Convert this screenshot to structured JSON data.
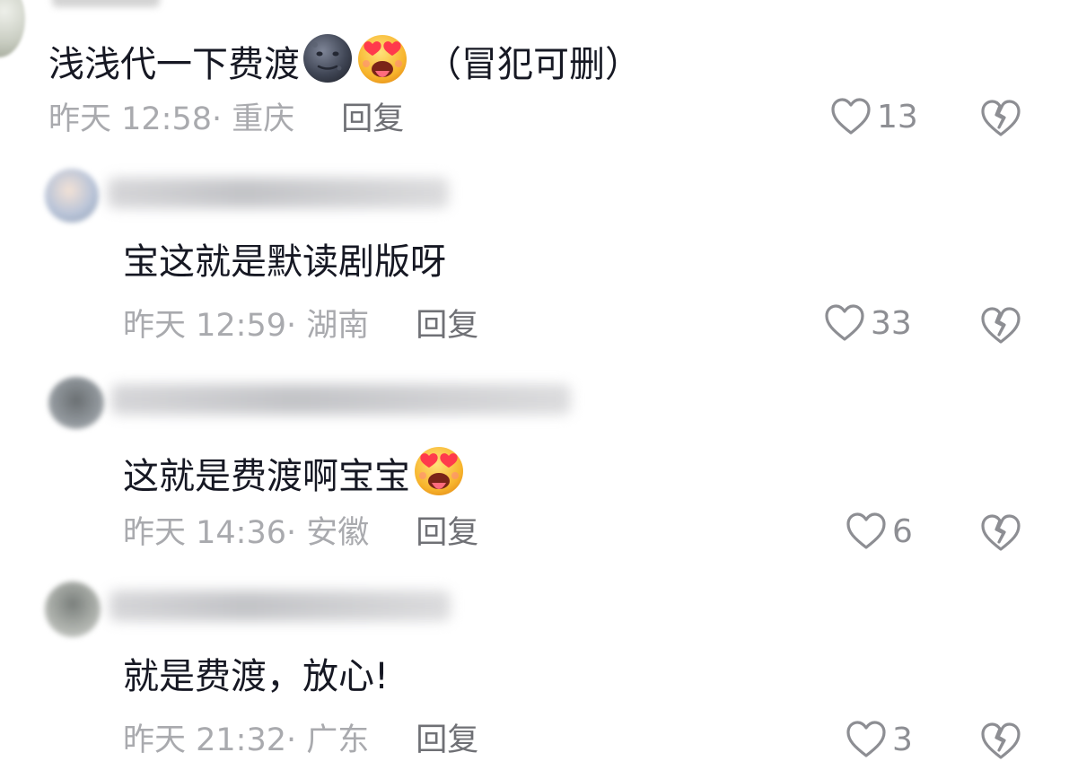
{
  "comments": [
    {
      "text": "浅浅代一下费渡",
      "suffix": "（冒犯可删）",
      "time": "昨天 12:58· 重庆",
      "reply": "回复",
      "likes": "13",
      "emojis": [
        "new-moon-face-emoji",
        "heart-eyes-tongue-emoji"
      ]
    },
    {
      "text": "宝这就是默读剧版呀",
      "time": "昨天 12:59· 湖南",
      "reply": "回复",
      "likes": "33"
    },
    {
      "text": "这就是费渡啊宝宝",
      "time": "昨天 14:36· 安徽",
      "reply": "回复",
      "likes": "6",
      "emojis": [
        "heart-eyes-tongue-emoji"
      ]
    },
    {
      "text": "就是费渡，放心!",
      "time": "昨天 21:32· 广东",
      "reply": "回复",
      "likes": "3"
    }
  ],
  "icons": {
    "like": "heart-outline-icon",
    "dislike": "broken-heart-icon"
  },
  "colors": {
    "text": "#161823",
    "meta": "#a9aaae",
    "reply": "#6f7075",
    "icon": "#8d8e93"
  }
}
